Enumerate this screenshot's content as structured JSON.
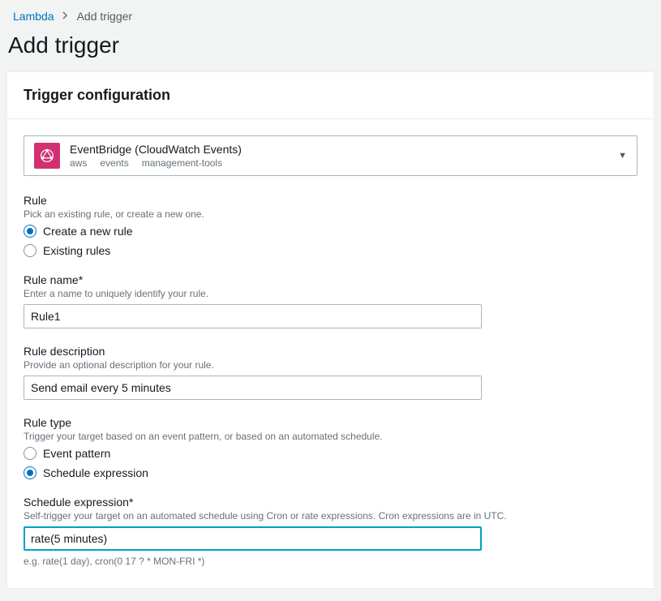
{
  "breadcrumb": {
    "root": "Lambda",
    "current": "Add trigger"
  },
  "page_title": "Add trigger",
  "panel_title": "Trigger configuration",
  "source": {
    "title": "EventBridge (CloudWatch Events)",
    "tags": [
      "aws",
      "events",
      "management-tools"
    ]
  },
  "rule_section": {
    "label": "Rule",
    "desc": "Pick an existing rule, or create a new one.",
    "options": {
      "create": "Create a new rule",
      "existing": "Existing rules"
    },
    "selected": "create"
  },
  "rule_name": {
    "label": "Rule name*",
    "desc": "Enter a name to uniquely identify your rule.",
    "value": "Rule1"
  },
  "rule_desc": {
    "label": "Rule description",
    "desc": "Provide an optional description for your rule.",
    "value": "Send email every 5 minutes"
  },
  "rule_type": {
    "label": "Rule type",
    "desc": "Trigger your target based on an event pattern, or based on an automated schedule.",
    "options": {
      "pattern": "Event pattern",
      "schedule": "Schedule expression"
    },
    "selected": "schedule"
  },
  "schedule": {
    "label": "Schedule expression*",
    "desc": "Self-trigger your target on an automated schedule using Cron or rate expressions. Cron expressions are in UTC.",
    "value": "rate(5 minutes)",
    "hint": "e.g. rate(1 day), cron(0 17 ? * MON-FRI *)"
  }
}
